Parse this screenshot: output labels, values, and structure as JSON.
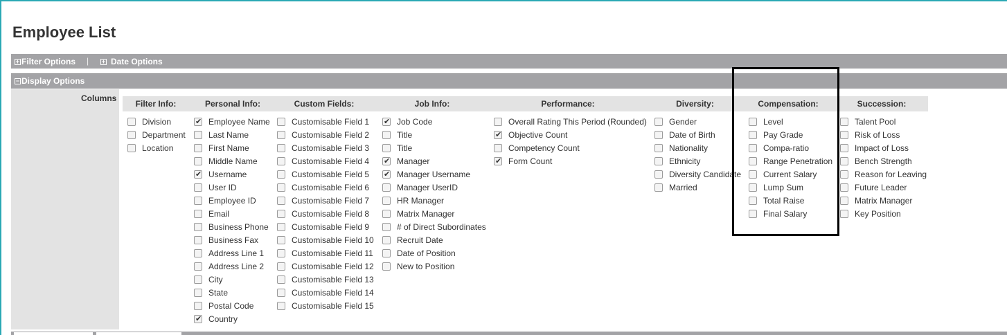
{
  "page": {
    "title": "Employee List"
  },
  "bars": {
    "filter_options": "Filter Options",
    "separator": "|",
    "date_options": "Date Options",
    "display_options": "Display Options",
    "expand_symbol": "+",
    "collapse_symbol": "−"
  },
  "columns_label": "Columns",
  "groups": [
    {
      "title": "Filter Info:",
      "items": [
        {
          "label": "Division",
          "checked": false
        },
        {
          "label": "Department",
          "checked": false
        },
        {
          "label": "Location",
          "checked": false
        }
      ]
    },
    {
      "title": "Personal Info:",
      "items": [
        {
          "label": "Employee Name",
          "checked": true
        },
        {
          "label": "Last Name",
          "checked": false
        },
        {
          "label": "First Name",
          "checked": false
        },
        {
          "label": "Middle Name",
          "checked": false
        },
        {
          "label": "Username",
          "checked": true
        },
        {
          "label": "User ID",
          "checked": false
        },
        {
          "label": "Employee ID",
          "checked": false
        },
        {
          "label": "Email",
          "checked": false
        },
        {
          "label": "Business Phone",
          "checked": false
        },
        {
          "label": "Business Fax",
          "checked": false
        },
        {
          "label": "Address Line 1",
          "checked": false
        },
        {
          "label": "Address Line 2",
          "checked": false
        },
        {
          "label": "City",
          "checked": false
        },
        {
          "label": "State",
          "checked": false
        },
        {
          "label": "Postal Code",
          "checked": false
        },
        {
          "label": "Country",
          "checked": true
        }
      ]
    },
    {
      "title": "Custom Fields:",
      "items": [
        {
          "label": "Customisable Field 1",
          "checked": false
        },
        {
          "label": "Customisable Field 2",
          "checked": false
        },
        {
          "label": "Customisable Field 3",
          "checked": false
        },
        {
          "label": "Customisable Field 4",
          "checked": false
        },
        {
          "label": "Customisable Field 5",
          "checked": false
        },
        {
          "label": "Customisable Field 6",
          "checked": false
        },
        {
          "label": "Customisable Field 7",
          "checked": false
        },
        {
          "label": "Customisable Field 8",
          "checked": false
        },
        {
          "label": "Customisable Field 9",
          "checked": false
        },
        {
          "label": "Customisable Field 10",
          "checked": false
        },
        {
          "label": "Customisable Field 11",
          "checked": false
        },
        {
          "label": "Customisable Field 12",
          "checked": false
        },
        {
          "label": "Customisable Field 13",
          "checked": false
        },
        {
          "label": "Customisable Field 14",
          "checked": false
        },
        {
          "label": "Customisable Field 15",
          "checked": false
        }
      ]
    },
    {
      "title": "Job Info:",
      "items": [
        {
          "label": "Job Code",
          "checked": true
        },
        {
          "label": "Title",
          "checked": false
        },
        {
          "label": "Title",
          "checked": false
        },
        {
          "label": "Manager",
          "checked": true
        },
        {
          "label": "Manager Username",
          "checked": true
        },
        {
          "label": "Manager UserID",
          "checked": false
        },
        {
          "label": "HR Manager",
          "checked": false
        },
        {
          "label": "Matrix Manager",
          "checked": false
        },
        {
          "label": "# of Direct Subordinates",
          "checked": false
        },
        {
          "label": "Recruit Date",
          "checked": false
        },
        {
          "label": "Date of Position",
          "checked": false
        },
        {
          "label": "New to Position",
          "checked": false
        }
      ]
    },
    {
      "title": "Performance:",
      "items": [
        {
          "label": "Overall Rating This Period (Rounded)",
          "checked": false
        },
        {
          "label": "Objective Count",
          "checked": true
        },
        {
          "label": "Competency Count",
          "checked": false
        },
        {
          "label": "Form Count",
          "checked": true
        }
      ]
    },
    {
      "title": "Diversity:",
      "items": [
        {
          "label": "Gender",
          "checked": false
        },
        {
          "label": "Date of Birth",
          "checked": false
        },
        {
          "label": "Nationality",
          "checked": false
        },
        {
          "label": "Ethnicity",
          "checked": false
        },
        {
          "label": "Diversity Candidate",
          "checked": false
        },
        {
          "label": "Married",
          "checked": false
        }
      ]
    },
    {
      "title": "Compensation:",
      "items": [
        {
          "label": "Level",
          "checked": false
        },
        {
          "label": "Pay Grade",
          "checked": false
        },
        {
          "label": "Compa-ratio",
          "checked": false
        },
        {
          "label": "Range Penetration",
          "checked": false
        },
        {
          "label": "Current Salary",
          "checked": false
        },
        {
          "label": "Lump Sum",
          "checked": false
        },
        {
          "label": "Total Raise",
          "checked": false
        },
        {
          "label": "Final Salary",
          "checked": false
        }
      ]
    },
    {
      "title": "Succession:",
      "items": [
        {
          "label": "Talent Pool",
          "checked": false
        },
        {
          "label": "Risk of Loss",
          "checked": false
        },
        {
          "label": "Impact of Loss",
          "checked": false
        },
        {
          "label": "Bench Strength",
          "checked": false
        },
        {
          "label": "Reason for Leaving",
          "checked": false
        },
        {
          "label": "Future Leader",
          "checked": false
        },
        {
          "label": "Matrix Manager",
          "checked": false
        },
        {
          "label": "Key Position",
          "checked": false
        }
      ]
    }
  ]
}
